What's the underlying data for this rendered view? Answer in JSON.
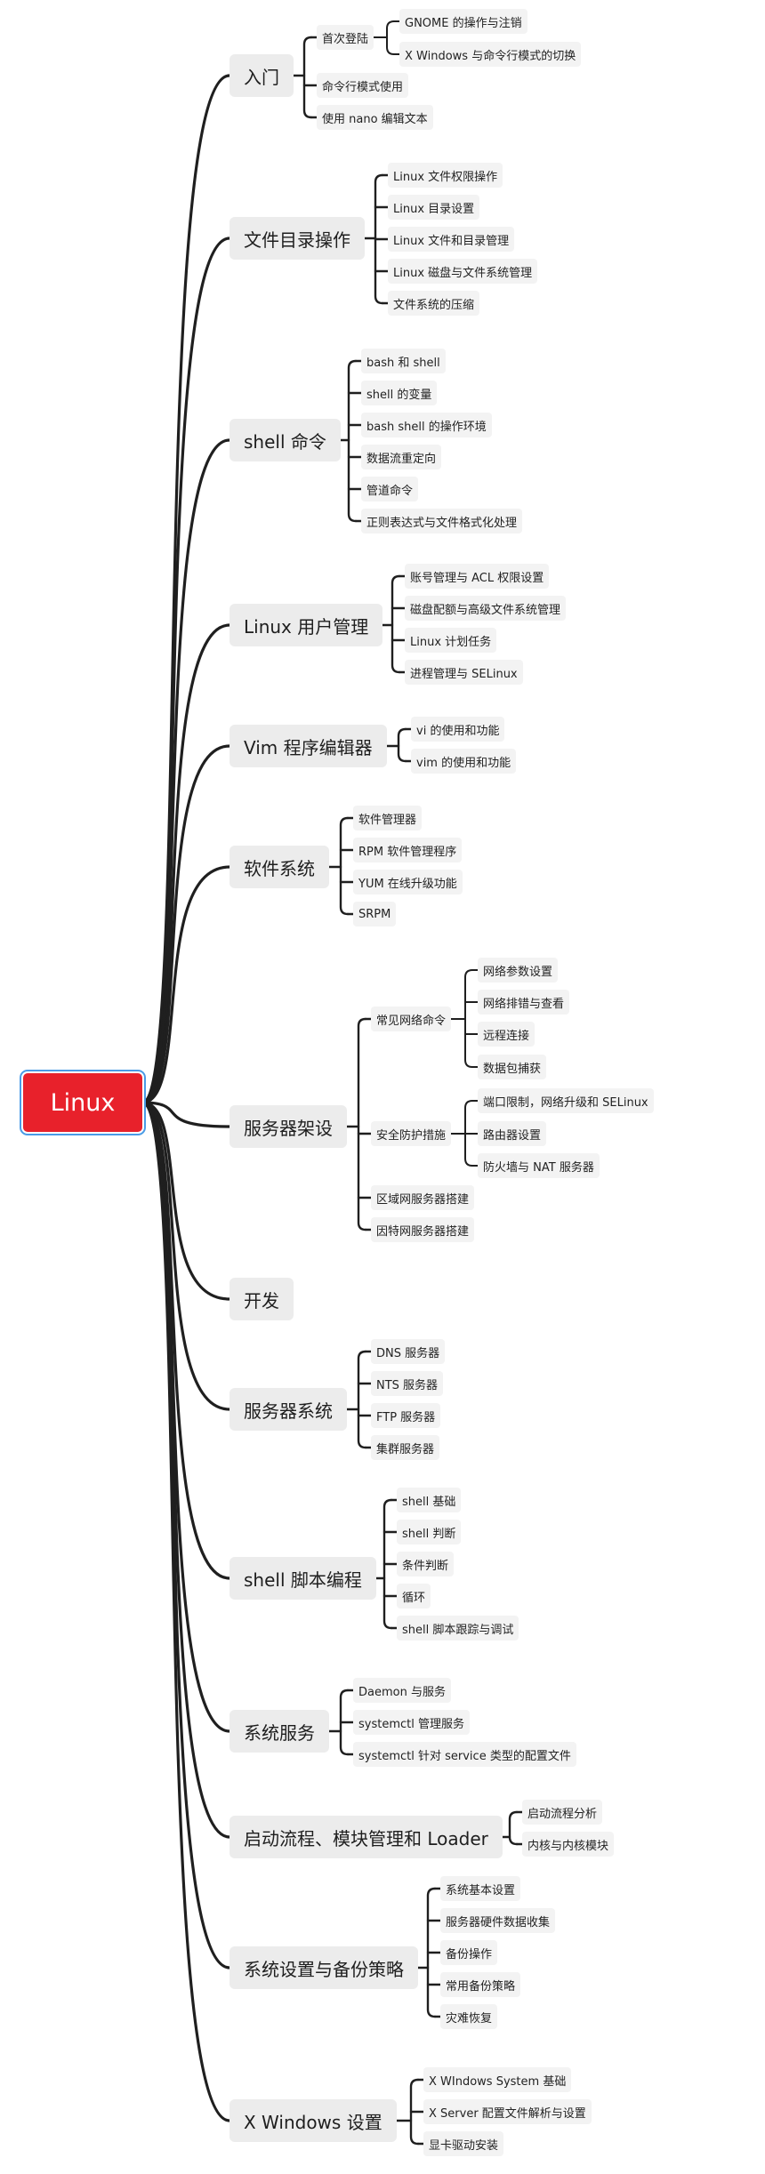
{
  "root": {
    "label": "Linux"
  },
  "branches": [
    {
      "label": "入门",
      "children": [
        {
          "label": "首次登陆",
          "children": [
            {
              "label": "GNOME 的操作与注销"
            },
            {
              "label": "X Windows 与命令行模式的切换"
            }
          ]
        },
        {
          "label": "命令行模式使用"
        },
        {
          "label": "使用 nano 编辑文本"
        }
      ]
    },
    {
      "label": "文件目录操作",
      "children": [
        {
          "label": "Linux 文件权限操作"
        },
        {
          "label": "Linux 目录设置"
        },
        {
          "label": "Linux 文件和目录管理"
        },
        {
          "label": "Linux 磁盘与文件系统管理"
        },
        {
          "label": "文件系统的压缩"
        }
      ]
    },
    {
      "label": "shell 命令",
      "children": [
        {
          "label": "bash 和 shell"
        },
        {
          "label": "shell 的变量"
        },
        {
          "label": "bash shell 的操作环境"
        },
        {
          "label": "数据流重定向"
        },
        {
          "label": "管道命令"
        },
        {
          "label": "正则表达式与文件格式化处理"
        }
      ]
    },
    {
      "label": "Linux 用户管理",
      "children": [
        {
          "label": "账号管理与 ACL 权限设置"
        },
        {
          "label": "磁盘配额与高级文件系统管理"
        },
        {
          "label": "Linux 计划任务"
        },
        {
          "label": "进程管理与 SELinux"
        }
      ]
    },
    {
      "label": "Vim 程序编辑器",
      "children": [
        {
          "label": "vi 的使用和功能"
        },
        {
          "label": "vim 的使用和功能"
        }
      ]
    },
    {
      "label": "软件系统",
      "children": [
        {
          "label": "软件管理器"
        },
        {
          "label": "RPM 软件管理程序"
        },
        {
          "label": "YUM 在线升级功能"
        },
        {
          "label": "SRPM"
        }
      ]
    },
    {
      "label": "服务器架设",
      "children": [
        {
          "label": "常见网络命令",
          "children": [
            {
              "label": "网络参数设置"
            },
            {
              "label": "网络排错与查看"
            },
            {
              "label": "远程连接"
            },
            {
              "label": "数据包捕获"
            }
          ]
        },
        {
          "label": "安全防护措施",
          "children": [
            {
              "label": "端口限制，网络升级和 SELinux"
            },
            {
              "label": "路由器设置"
            },
            {
              "label": "防火墙与 NAT 服务器"
            }
          ]
        },
        {
          "label": "区域网服务器搭建"
        },
        {
          "label": "因特网服务器搭建"
        }
      ]
    },
    {
      "label": "开发",
      "children": []
    },
    {
      "label": "服务器系统",
      "children": [
        {
          "label": "DNS 服务器"
        },
        {
          "label": "NTS 服务器"
        },
        {
          "label": "FTP 服务器"
        },
        {
          "label": "集群服务器"
        }
      ]
    },
    {
      "label": "shell 脚本编程",
      "children": [
        {
          "label": "shell 基础"
        },
        {
          "label": "shell 判断"
        },
        {
          "label": "条件判断"
        },
        {
          "label": "循环"
        },
        {
          "label": "shell 脚本跟踪与调试"
        }
      ]
    },
    {
      "label": "系统服务",
      "children": [
        {
          "label": "Daemon 与服务"
        },
        {
          "label": "systemctl 管理服务"
        },
        {
          "label": "systemctl 针对 service 类型的配置文件"
        }
      ]
    },
    {
      "label": "启动流程、模块管理和 Loader",
      "children": [
        {
          "label": "启动流程分析"
        },
        {
          "label": "内核与内核模块"
        }
      ]
    },
    {
      "label": "系统设置与备份策略",
      "children": [
        {
          "label": "系统基本设置"
        },
        {
          "label": "服务器硬件数据收集"
        },
        {
          "label": "备份操作"
        },
        {
          "label": "常用备份策略"
        },
        {
          "label": "灾难恢复"
        }
      ]
    },
    {
      "label": "X Windows 设置",
      "children": [
        {
          "label": "X WIndows System 基础"
        },
        {
          "label": "X Server 配置文件解析与设置"
        },
        {
          "label": "显卡驱动安装"
        }
      ]
    }
  ],
  "colors": {
    "root_fill": "#e8212b",
    "root_text": "#ffffff",
    "topic_fill": "#ececec",
    "subtopic_fill": "#f3f3f3",
    "line": "#1f1f1f"
  }
}
